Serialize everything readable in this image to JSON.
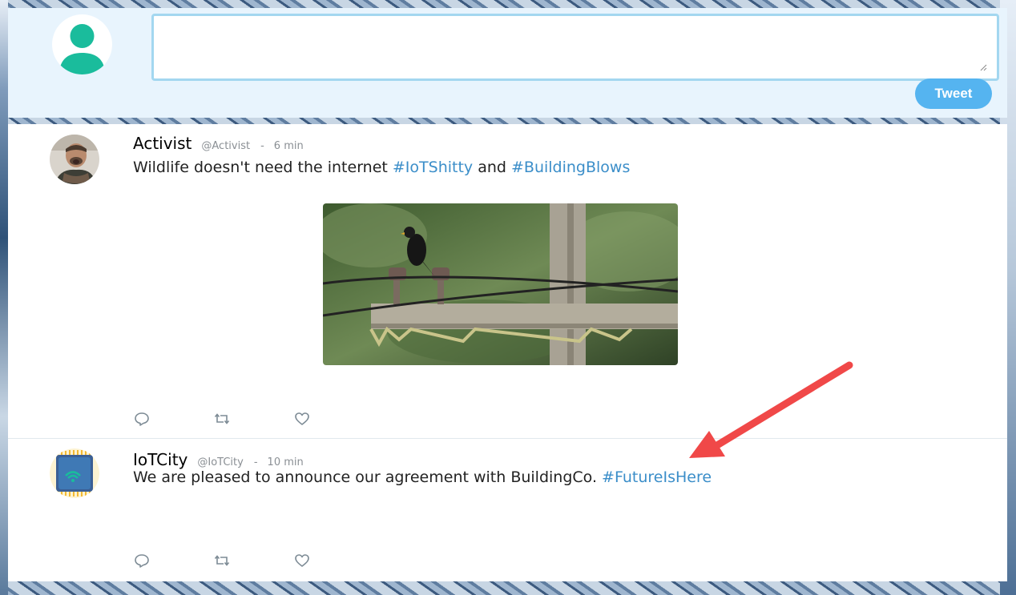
{
  "composer": {
    "textarea_value": "",
    "tweet_button_label": "Tweet"
  },
  "tweets": [
    {
      "name": "Activist",
      "handle": "@Activist",
      "separator": "-",
      "time": "6 min",
      "text_parts": [
        "Wildlife doesn't need the internet ",
        "#IoTShitty",
        " and ",
        "#BuildingBlows"
      ]
    },
    {
      "name": "IoTCity",
      "handle": "@IoTCity",
      "separator": "-",
      "time": "10 min",
      "text_parts": [
        "We are pleased to announce our agreement with BuildingCo. ",
        "#FutureIsHere"
      ]
    }
  ],
  "colors": {
    "composer_bg": "#e8f4fd",
    "tweet_button": "#55b4f0",
    "hashtag": "#3b8ec9",
    "default_avatar": "#1abc9c",
    "annotation_arrow": "#f04848"
  },
  "icons": [
    "default-user-icon",
    "reply-icon",
    "retweet-icon",
    "like-icon",
    "annotation-arrow"
  ]
}
